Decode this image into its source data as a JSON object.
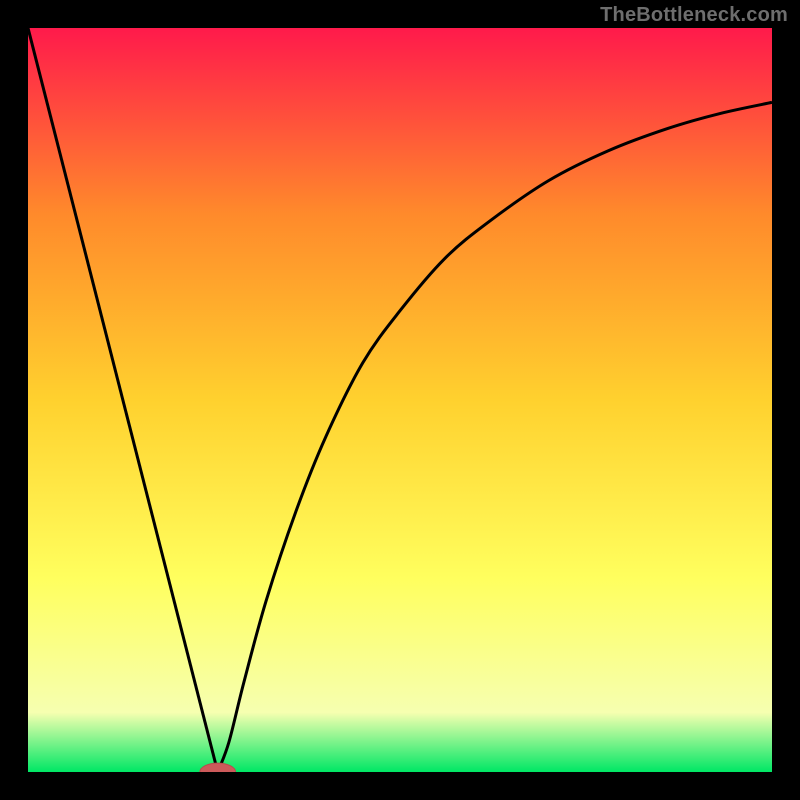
{
  "watermark": "TheBottleneck.com",
  "chart_data": {
    "type": "line",
    "title": "",
    "xlabel": "",
    "ylabel": "",
    "xlim": [
      0,
      100
    ],
    "ylim": [
      0,
      100
    ],
    "background_gradient": {
      "top": "#ff1a4b",
      "mid_upper": "#ff8a2b",
      "mid": "#ffd12e",
      "mid_lower": "#ffff5e",
      "lower": "#f6ffb0",
      "bottom": "#00e765"
    },
    "series": [
      {
        "name": "left-branch",
        "x": [
          0,
          25.5
        ],
        "y": [
          100,
          0
        ]
      },
      {
        "name": "right-branch",
        "x": [
          25.5,
          27,
          29,
          32,
          36,
          40,
          45,
          50,
          56,
          62,
          70,
          78,
          86,
          93,
          100
        ],
        "y": [
          0,
          4,
          12,
          23,
          35,
          45,
          55,
          62,
          69,
          74,
          79.5,
          83.5,
          86.5,
          88.5,
          90
        ]
      }
    ],
    "marker": {
      "name": "min-point",
      "x": 25.5,
      "y": 0,
      "rx": 2.4,
      "ry": 1.2,
      "color": "#cc5a5a"
    }
  }
}
